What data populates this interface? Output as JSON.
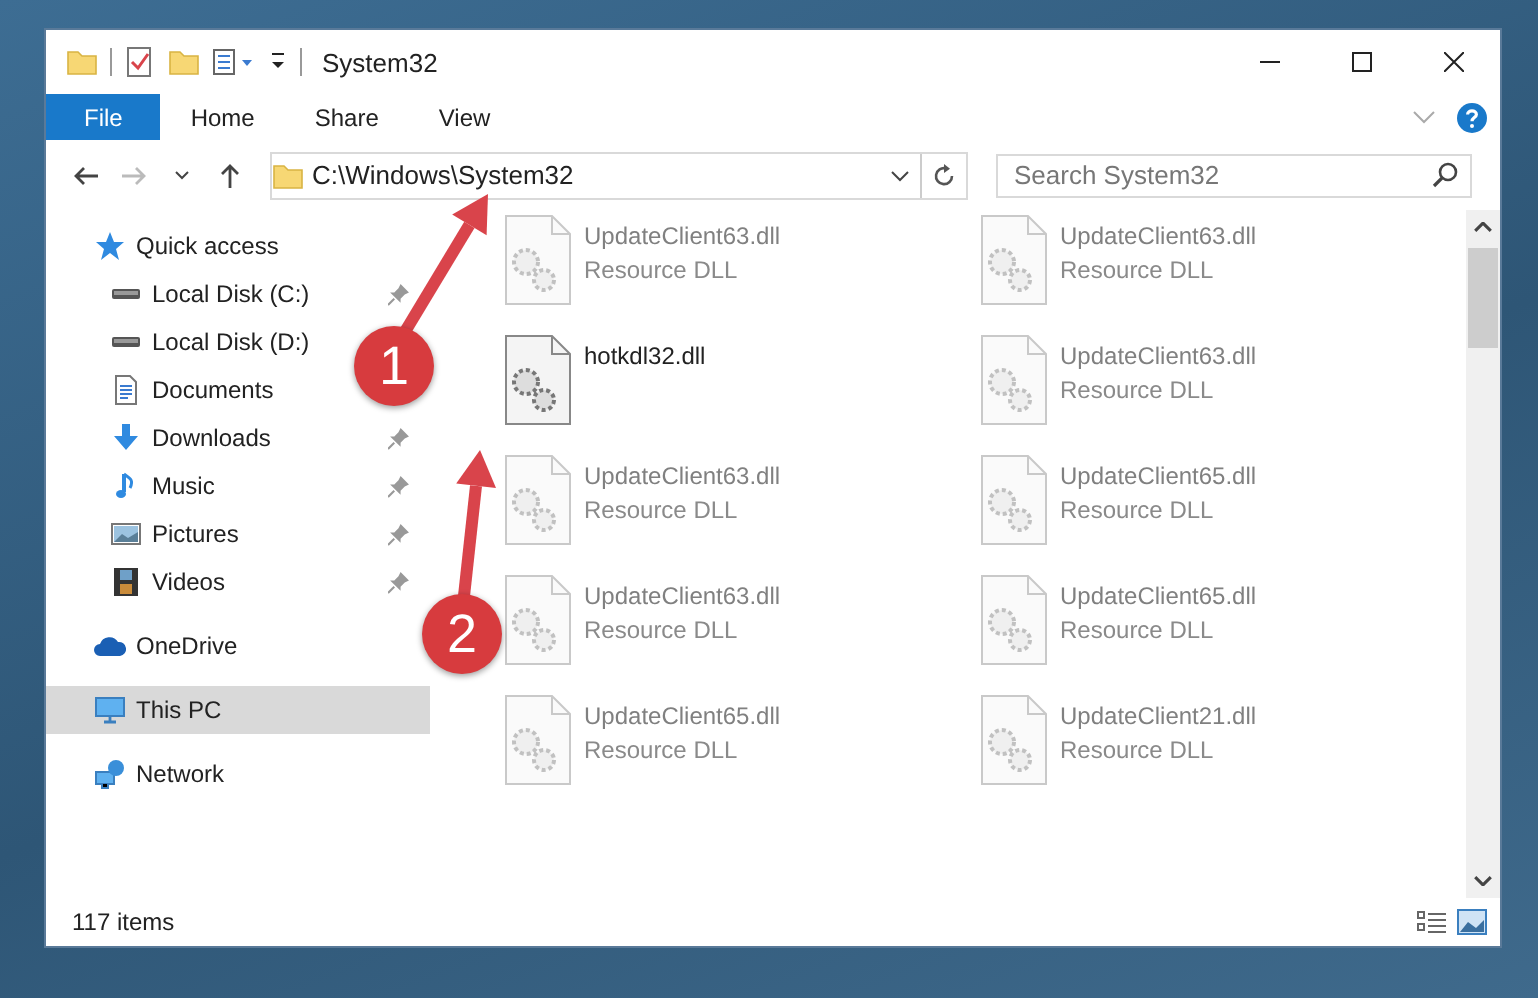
{
  "window": {
    "title": "System32"
  },
  "ribbon_tabs": [
    {
      "label": "File",
      "selected": true
    },
    {
      "label": "Home",
      "selected": false
    },
    {
      "label": "Share",
      "selected": false
    },
    {
      "label": "View",
      "selected": false
    }
  ],
  "address": {
    "path": "C:\\Windows\\System32"
  },
  "search": {
    "placeholder": "Search System32"
  },
  "sidebar": {
    "items": [
      {
        "label": "Quick access",
        "kind": "star",
        "selected": false,
        "children": [
          {
            "label": "Local Disk (C:)",
            "kind": "drive",
            "pinned": true,
            "selected": false
          },
          {
            "label": "Local Disk (D:)",
            "kind": "drive",
            "selected": false
          },
          {
            "label": "Documents",
            "kind": "document",
            "selected": false
          },
          {
            "label": "Downloads",
            "kind": "download",
            "pinned": true,
            "selected": false
          },
          {
            "label": "Music",
            "kind": "music",
            "pinned": true,
            "selected": false
          },
          {
            "label": "Pictures",
            "kind": "pictures",
            "pinned": true,
            "selected": false
          },
          {
            "label": "Videos",
            "kind": "video",
            "pinned": true,
            "selected": false
          }
        ]
      },
      {
        "label": "OneDrive",
        "kind": "cloud",
        "selected": false
      },
      {
        "label": "This PC",
        "kind": "pc",
        "selected": true
      },
      {
        "label": "Network",
        "kind": "network",
        "selected": false
      }
    ]
  },
  "files": [
    {
      "name": "UpdateClient63.dll",
      "type": "Resource DLL",
      "blurred": true
    },
    {
      "name": "UpdateClient63.dll",
      "type": "Resource DLL",
      "blurred": true
    },
    {
      "name": "hotkdl32.dll",
      "blurred": false
    },
    {
      "name": "UpdateClient63.dll",
      "type": "Resource DLL",
      "blurred": true
    },
    {
      "name": "UpdateClient63.dll",
      "type": "Resource DLL",
      "blurred": true
    },
    {
      "name": "UpdateClient65.dll",
      "type": "Resource DLL",
      "blurred": true
    },
    {
      "name": "UpdateClient63.dll",
      "type": "Resource DLL",
      "blurred": true
    },
    {
      "name": "UpdateClient65.dll",
      "type": "Resource DLL",
      "blurred": true
    },
    {
      "name": "UpdateClient65.dll",
      "type": "Resource DLL",
      "blurred": true
    },
    {
      "name": "UpdateClient21.dll",
      "type": "Resource DLL",
      "blurred": true
    }
  ],
  "status_bar": {
    "item_count": "117 items"
  },
  "annotations": [
    {
      "number": "1"
    },
    {
      "number": "2"
    }
  ]
}
